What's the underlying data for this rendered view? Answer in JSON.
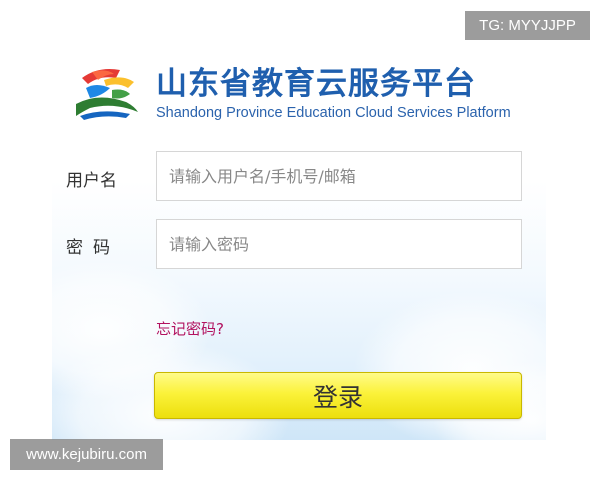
{
  "header": {
    "title_cn": "山东省教育云服务平台",
    "title_en": "Shandong Province Education Cloud Services Platform",
    "logo_icon": "sd-education-cloud-logo-icon"
  },
  "form": {
    "username": {
      "label": "用户名",
      "placeholder": "请输入用户名/手机号/邮箱",
      "value": ""
    },
    "password": {
      "label": "密码",
      "placeholder": "请输入密码",
      "value": ""
    },
    "forgot_password": "忘记密码?",
    "login_button": "登录"
  },
  "watermarks": {
    "top_right": "TG: MYYJJPP",
    "bottom_left": "www.kejubiru.com"
  },
  "colors": {
    "title_blue": "#1f5fae",
    "link_magenta": "#b2125f",
    "button_yellow": "#fbf23a"
  }
}
